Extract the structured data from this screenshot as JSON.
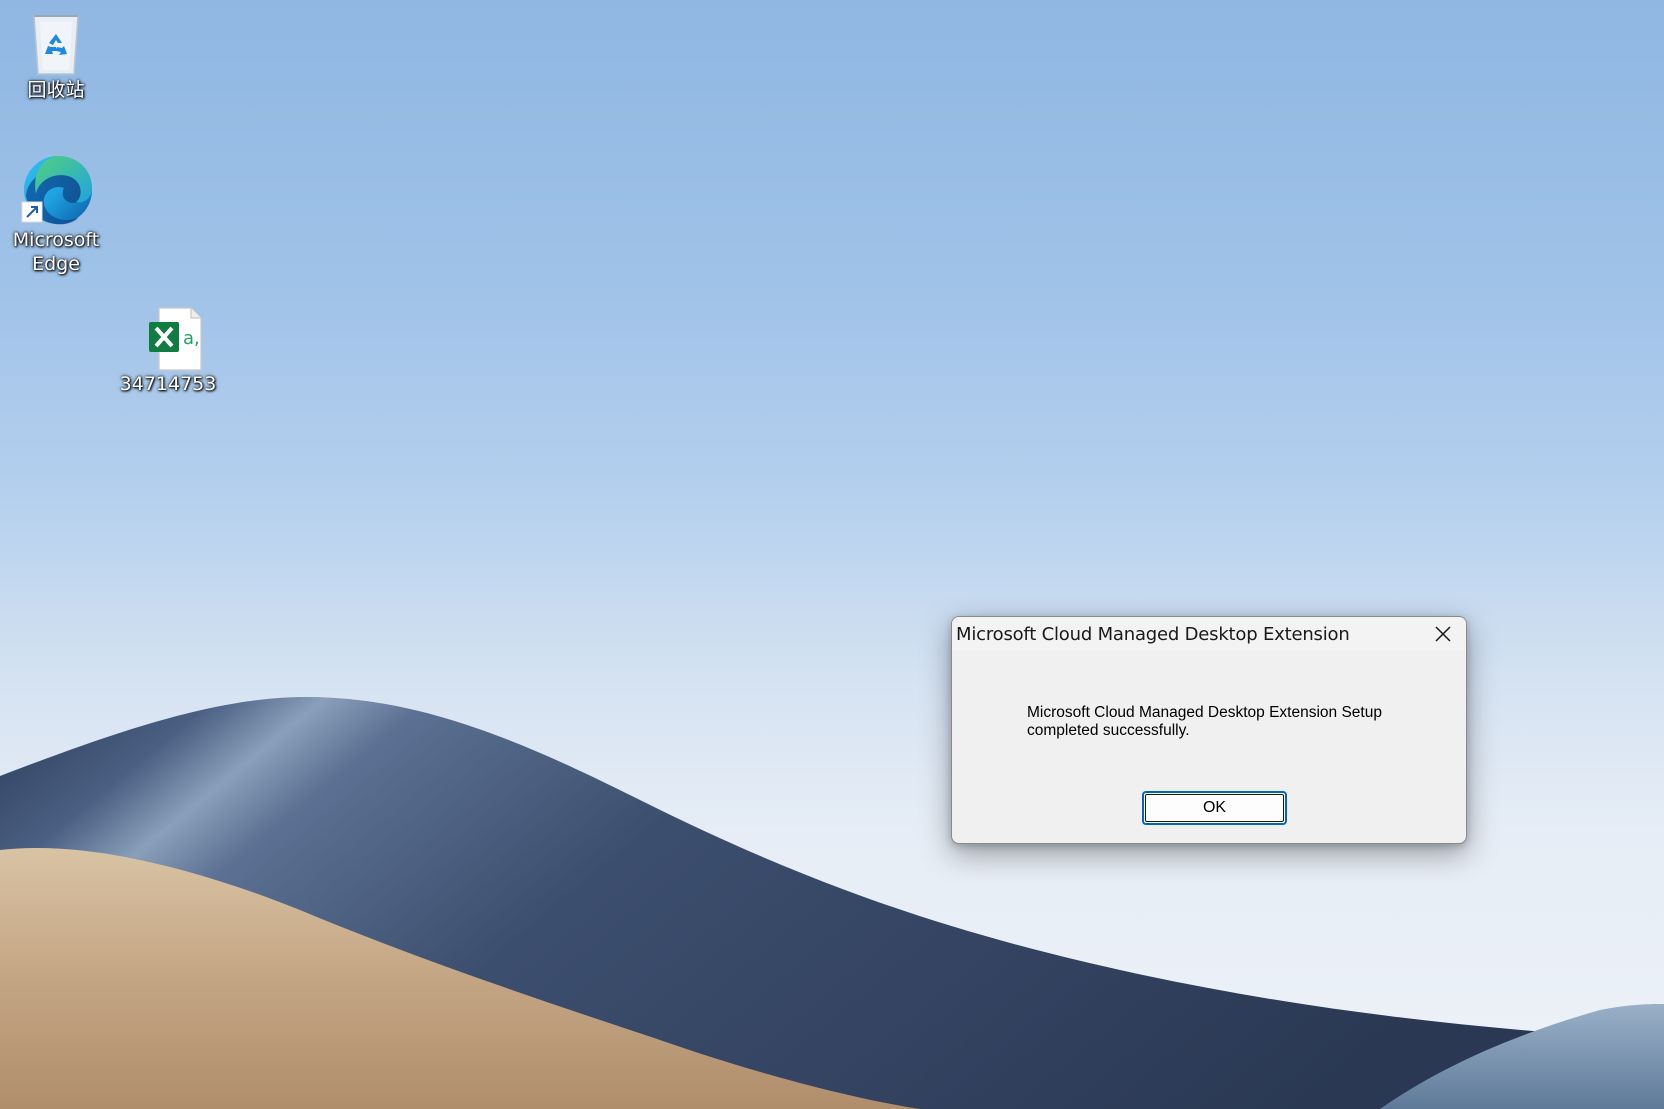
{
  "desktop": {
    "icons": [
      {
        "label": "回收站",
        "icon": "recycle-bin-icon"
      },
      {
        "label": "Microsoft Edge",
        "icon": "edge-icon"
      },
      {
        "label": "34714753",
        "icon": "excel-csv-icon"
      }
    ]
  },
  "dialog": {
    "title": "Microsoft Cloud Managed Desktop Extension",
    "message": "Microsoft Cloud Managed Desktop Extension Setup completed successfully.",
    "ok_label": "OK",
    "close_icon": "close-icon"
  },
  "colors": {
    "accent": "#0067c0",
    "dialog_bg": "#f0f0f0"
  }
}
